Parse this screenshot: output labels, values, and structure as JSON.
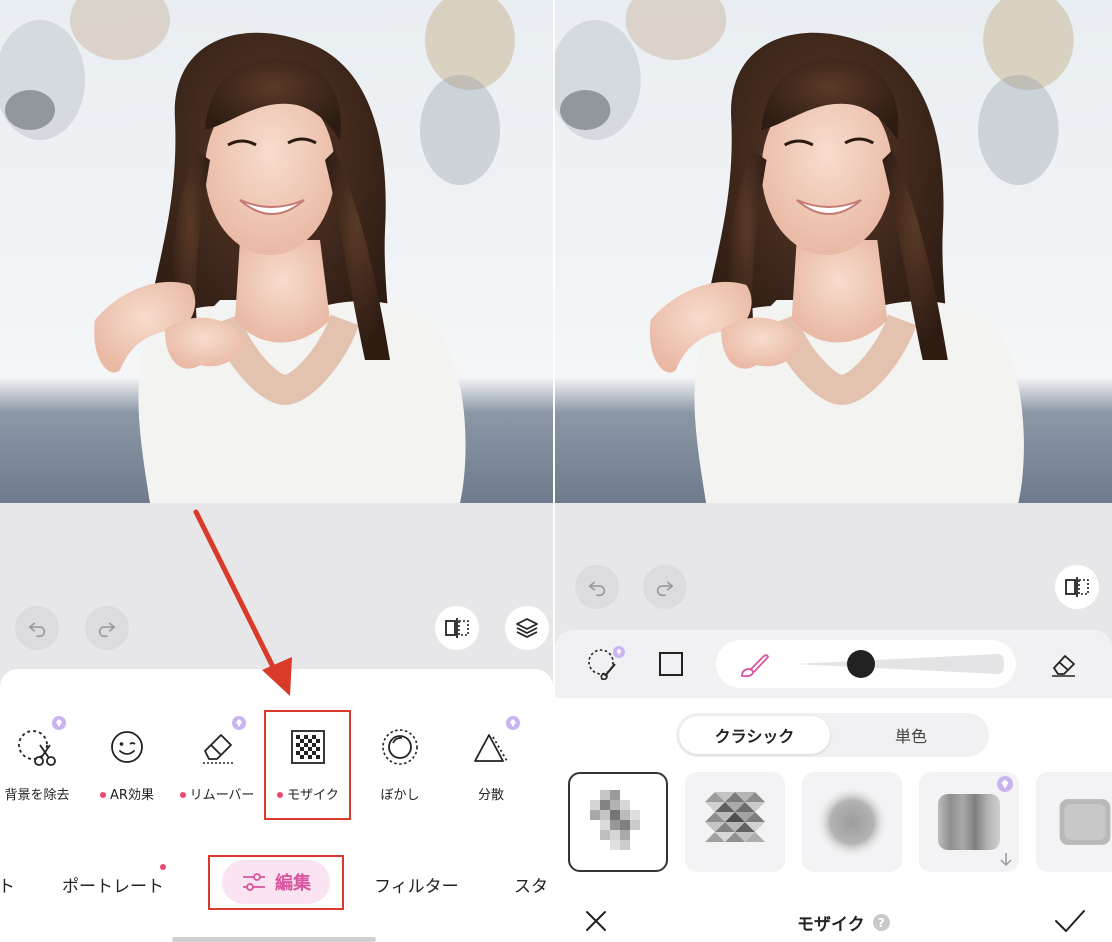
{
  "left": {
    "tools": [
      {
        "label": "背景を除去",
        "icon": "cutout-scissors-icon",
        "dot": false,
        "premium": true
      },
      {
        "label": "AR効果",
        "icon": "smile-face-icon",
        "dot": true,
        "premium": false
      },
      {
        "label": "リムーバー",
        "icon": "eraser-icon",
        "dot": true,
        "premium": true
      },
      {
        "label": "モザイク",
        "icon": "mosaic-icon",
        "dot": true,
        "premium": false
      },
      {
        "label": "ぼかし",
        "icon": "blur-circle-icon",
        "dot": false,
        "premium": false
      },
      {
        "label": "分散",
        "icon": "disperse-triangle-icon",
        "dot": false,
        "premium": true
      }
    ],
    "tabs": {
      "partial_left": "ト",
      "portrait": "ポートレート",
      "edit": "編集",
      "filter": "フィルター",
      "partial_right": "スタ"
    }
  },
  "right": {
    "segments": {
      "classic": "クラシック",
      "solid": "単色"
    },
    "bottom_title": "モザイク",
    "help": "?"
  },
  "colors": {
    "accent_pink": "#d8559f",
    "annotation_red": "#d93a2a",
    "sheet_gray": "#e7e7e9"
  }
}
